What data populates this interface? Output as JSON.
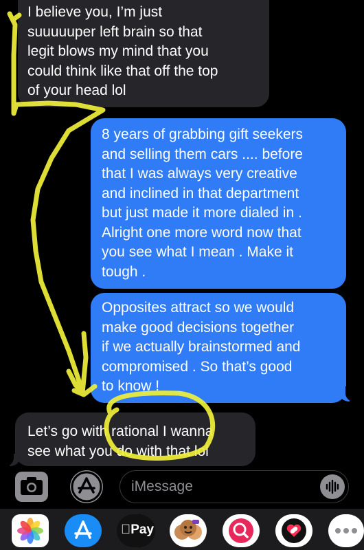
{
  "conversation": {
    "messages": [
      {
        "sender": "other",
        "text": "I believe you, I’m just\nsuuuuuper left brain so that\nlegit blows my mind that you\ncould think like that off the top\nof your head lol"
      },
      {
        "sender": "me",
        "text": "8 years of grabbing gift seekers\nand selling them cars .... before\nthat I was always very creative\nand inclined in that department\nbut just made it more dialed in .\nAlright one more word now that\nyou see what I mean . Make it\ntough ."
      },
      {
        "sender": "me",
        "text": "Opposites attract so we would\nmake good decisions together\nif we actually brainstormed and\ncompromised . So that’s good\nto know !"
      },
      {
        "sender": "other",
        "text": "Let’s go with rational I wanna\nsee what you do with that lol"
      }
    ]
  },
  "composer": {
    "placeholder": "iMessage"
  },
  "app_drawer": {
    "applepay_label": "Pay",
    "apps": [
      "photos-icon",
      "app-store-icon",
      "apple-pay-icon",
      "memoji-icon",
      "search-icon",
      "fitness-icon",
      "more-icon"
    ]
  },
  "colors": {
    "background": "#000000",
    "incoming_bubble": "#26262a",
    "outgoing_bubble": "#2f7cf6",
    "highlighter": "#f0f03a"
  }
}
